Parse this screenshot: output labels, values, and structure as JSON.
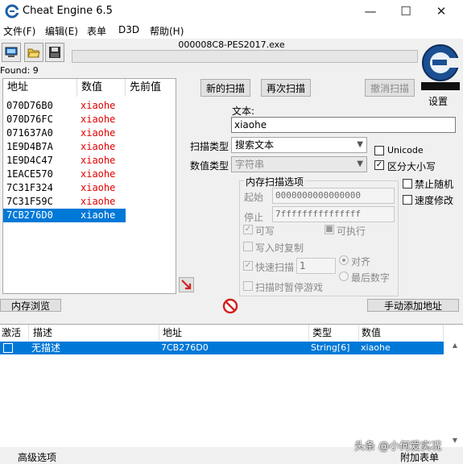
{
  "window": {
    "title": "Cheat Engine 6.5",
    "minimize": "—",
    "maximize": "☐",
    "close": "✕"
  },
  "menu": [
    "文件(F)",
    "编辑(E)",
    "表单",
    "D3D",
    "帮助(H)"
  ],
  "toolbar": {
    "process_name": "000008C8-PES2017.exe",
    "found": "Found: 9"
  },
  "settings_label": "设置",
  "results": {
    "columns": [
      "地址",
      "数值",
      "先前值"
    ],
    "rows": [
      {
        "address": "070D76B0",
        "value": "xiaohe"
      },
      {
        "address": "070D76FC",
        "value": "xiaohe"
      },
      {
        "address": "071637A0",
        "value": "xiaohe"
      },
      {
        "address": "1E9D4B7A",
        "value": "xiaohe"
      },
      {
        "address": "1E9D4C47",
        "value": "xiaohe"
      },
      {
        "address": "1EACE570",
        "value": "xiaohe"
      },
      {
        "address": "7C31F324",
        "value": "xiaohe"
      },
      {
        "address": "7C31F59C",
        "value": "xiaohe"
      },
      {
        "address": "7CB276D0",
        "value": "xiaohe"
      }
    ]
  },
  "scan": {
    "new_scan": "新的扫描",
    "next_scan": "再次扫描",
    "undo_scan": "撤消扫描",
    "text_label": "文本:",
    "text_value": "xiaohe",
    "scan_type_label": "扫描类型",
    "scan_type_value": "搜索文本",
    "value_type_label": "数值类型",
    "value_type_value": "字符串",
    "unicode": "Unicode",
    "case_sensitive": "区分大小写",
    "disable_random": "禁止随机",
    "speedhack": "速度修改",
    "memopts_title": "内存扫描选项",
    "start_label": "起始",
    "start_value": "0000000000000000",
    "stop_label": "停止",
    "stop_value": "7fffffffffffffff",
    "writable": "可写",
    "executable": "可执行",
    "copy_on_write": "写入时复制",
    "fast_scan": "快速扫描",
    "fast_scan_value": "1",
    "alignment": "对齐",
    "last_digits": "最后数字",
    "pause_game": "扫描时暂停游戏"
  },
  "buttons": {
    "memory_view": "内存浏览",
    "add_manual": "手动添加地址"
  },
  "addrlist": {
    "columns": [
      "激活",
      "描述",
      "地址",
      "类型",
      "数值"
    ],
    "rows": [
      {
        "description": "无描述",
        "address": "7CB276D0",
        "type": "String[6]",
        "value": "xiaohe"
      }
    ]
  },
  "footer": {
    "advanced": "高级选项",
    "table_extras": "附加表单",
    "watermark": "头条 @小何爱实况"
  }
}
